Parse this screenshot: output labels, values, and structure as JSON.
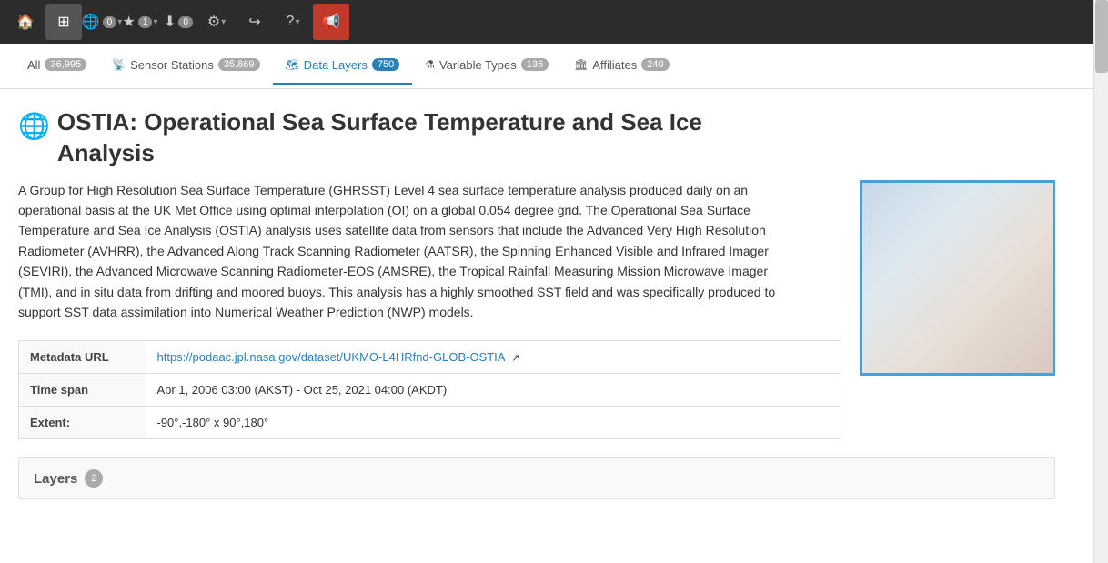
{
  "topnav": {
    "home_icon": "🏠",
    "grid_icon": "⊞",
    "globe_icon": "🌐",
    "counter1": "0",
    "star_icon": "★",
    "counter2": "1",
    "download_icon": "⬇",
    "counter3": "0",
    "gear_icon": "⚙",
    "share_icon": "↪",
    "help_icon": "?",
    "announce_icon": "📢"
  },
  "filter_tabs": [
    {
      "id": "all",
      "label": "All",
      "count": "36,995",
      "active": false
    },
    {
      "id": "sensor-stations",
      "label": "Sensor Stations",
      "count": "35,869",
      "active": false
    },
    {
      "id": "data-layers",
      "label": "Data Layers",
      "count": "750",
      "active": true
    },
    {
      "id": "variable-types",
      "label": "Variable Types",
      "count": "136",
      "active": false
    },
    {
      "id": "affiliates",
      "label": "Affiliates",
      "count": "240",
      "active": false
    }
  ],
  "resource": {
    "title_line1": "OSTIA: Operational Sea Surface Temperature and Sea Ice",
    "title_line2": "Analysis",
    "description": "A Group for High Resolution Sea Surface Temperature (GHRSST) Level 4 sea surface temperature analysis produced daily on an operational basis at the UK Met Office using optimal interpolation (OI) on a global 0.054 degree grid. The Operational Sea Surface Temperature and Sea Ice Analysis (OSTIA) analysis uses satellite data from sensors that include the Advanced Very High Resolution Radiometer (AVHRR), the Advanced Along Track Scanning Radiometer (AATSR), the Spinning Enhanced Visible and Infrared Imager (SEVIRI), the Advanced Microwave Scanning Radiometer-EOS (AMSRE), the Tropical Rainfall Measuring Mission Microwave Imager (TMI), and in situ data from drifting and moored buoys. This analysis has a highly smoothed SST field and was specifically produced to support SST data assimilation into Numerical Weather Prediction (NWP) models.",
    "metadata_url_label": "Metadata URL",
    "metadata_url": "https://podaac.jpl.nasa.gov/dataset/UKMO-L4HRfnd-GLOB-OSTIA",
    "time_span_label": "Time span",
    "time_span_value": "Apr 1, 2006 03:00 (AKST) - Oct 25, 2021 04:00 (AKDT)",
    "extent_label": "Extent:",
    "extent_value": "-90°,-180° x 90°,180°",
    "layers_label": "Layers",
    "layers_count": "2"
  }
}
